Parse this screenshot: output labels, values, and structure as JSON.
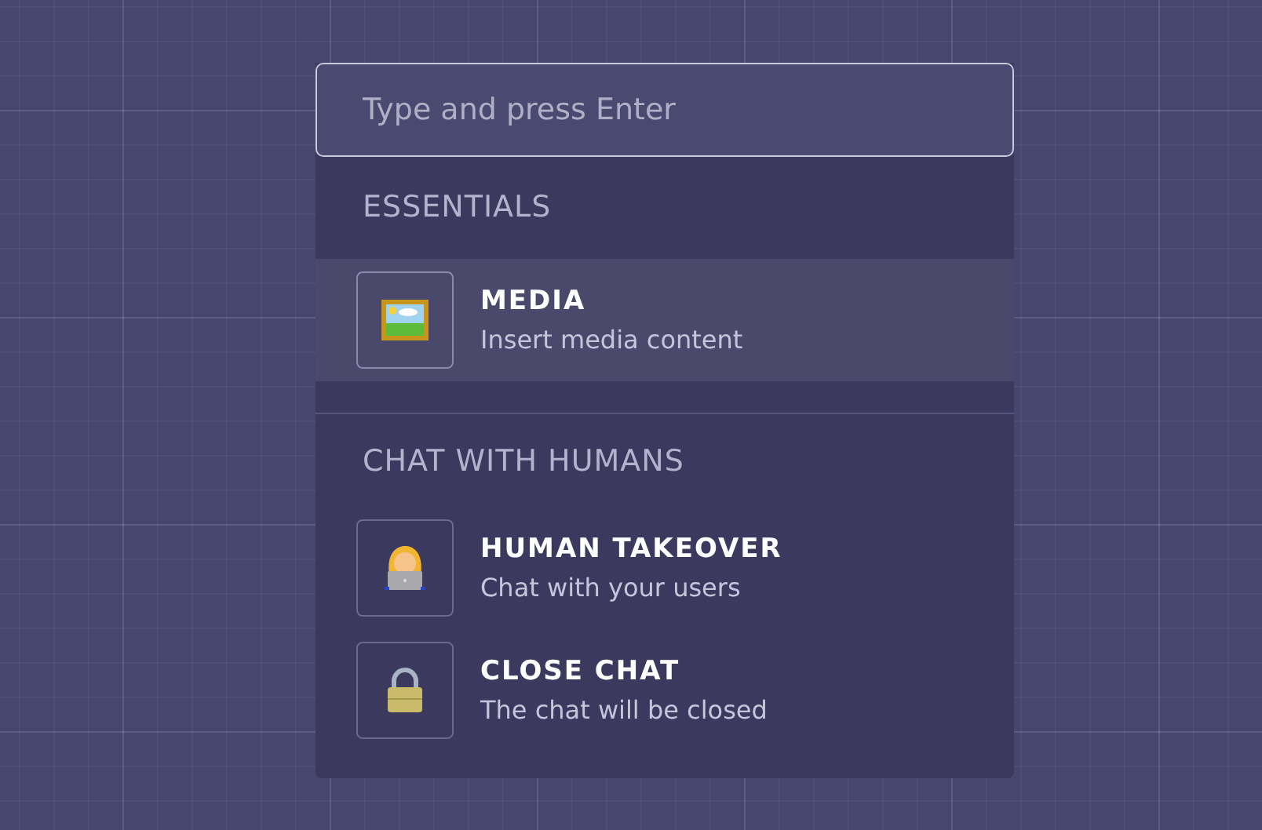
{
  "search": {
    "placeholder": "Type and press Enter"
  },
  "sections": [
    {
      "title": "ESSENTIALS",
      "items": [
        {
          "kind": "picture",
          "title": "MEDIA",
          "subtitle": "Insert media content",
          "selected": true
        }
      ]
    },
    {
      "title": "CHAT WITH HUMANS",
      "items": [
        {
          "kind": "person",
          "title": "HUMAN TAKEOVER",
          "subtitle": "Chat with your users",
          "selected": false
        },
        {
          "kind": "lock",
          "title": "CLOSE CHAT",
          "subtitle": "The chat will be closed",
          "selected": false
        }
      ]
    }
  ]
}
